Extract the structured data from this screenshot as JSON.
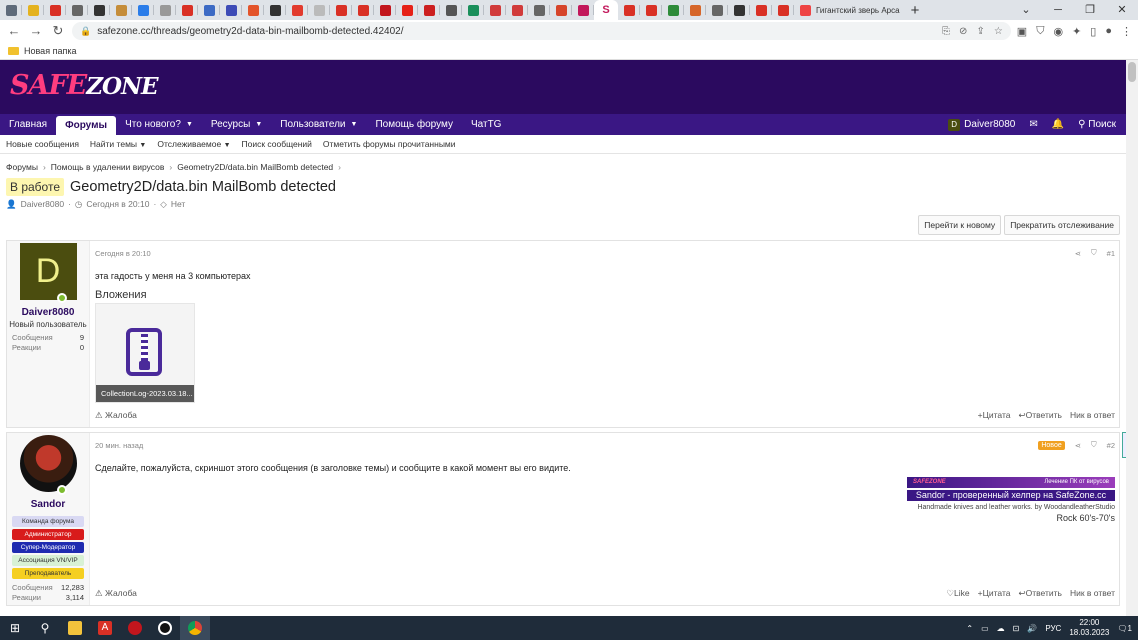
{
  "browser": {
    "tabs": [
      {
        "icon": "gray-tile-icon",
        "color": "#5f6b7a"
      },
      {
        "icon": "yellow-tile-icon",
        "color": "#e4b21f"
      },
      {
        "icon": "acrobat-icon",
        "color": "#d93025"
      },
      {
        "icon": "settings-icon",
        "color": "#666666"
      },
      {
        "icon": "drop-icon",
        "color": "#333333"
      },
      {
        "icon": "image-icon",
        "color": "#c58d3a"
      },
      {
        "icon": "star-icon",
        "color": "#2b7de9"
      },
      {
        "icon": "gear-icon",
        "color": "#999999"
      },
      {
        "icon": "pdf-icon",
        "color": "#d93025"
      },
      {
        "icon": "blue-tile-icon",
        "color": "#3c6ac4"
      },
      {
        "icon": "wb-icon",
        "color": "#3d4bb6"
      },
      {
        "icon": "flame-icon",
        "color": "#e3542b"
      },
      {
        "icon": "circle-icon",
        "color": "#333333"
      },
      {
        "icon": "pin-icon",
        "color": "#e23b2e"
      },
      {
        "icon": "t-icon",
        "color": "#bbbbbb"
      },
      {
        "icon": "acrobat-icon",
        "color": "#d93025"
      },
      {
        "icon": "acrobat-icon",
        "color": "#d93025"
      },
      {
        "icon": "opera-icon",
        "color": "#c2161d"
      },
      {
        "icon": "youtube-icon",
        "color": "#e62117"
      },
      {
        "icon": "tomato-icon",
        "color": "#cc1f1f"
      },
      {
        "icon": "smile-icon",
        "color": "#555555"
      },
      {
        "icon": "green-tile-icon",
        "color": "#1a8f5b"
      },
      {
        "icon": "red-tile-icon",
        "color": "#d13b3b"
      },
      {
        "icon": "blocked-icon",
        "color": "#d13b3b"
      },
      {
        "icon": "globe-icon",
        "color": "#666666"
      },
      {
        "icon": "flower-icon",
        "color": "#d6442a"
      },
      {
        "icon": "safezone-icon",
        "color": "#c2185b"
      }
    ],
    "active_tab_icon": "safezone-icon",
    "tabs_after": [
      {
        "icon": "acrobat-icon",
        "color": "#d93025"
      },
      {
        "icon": "acrobat-icon",
        "color": "#d93025"
      },
      {
        "icon": "green-grid-icon",
        "color": "#2e8b3a"
      },
      {
        "icon": "pizza-icon",
        "color": "#d6662a"
      },
      {
        "icon": "globe-icon",
        "color": "#666666"
      },
      {
        "icon": "circle-icon",
        "color": "#333333"
      },
      {
        "icon": "acrobat-icon",
        "color": "#d93025"
      },
      {
        "icon": "acrobat-icon",
        "color": "#d93025"
      }
    ],
    "wide_tab_title": "Гигантский зверь Арса",
    "address": "safezone.cc/threads/geometry2d-data-bin-mailbomb-detected.42402/",
    "bookmark_folder": "Новая папка"
  },
  "site": {
    "logo_safe": "SAFE",
    "logo_zone": "ZONE",
    "colors": {
      "header": "#2b0a5f",
      "nav": "#3a1784",
      "accent": "#ff3d7f"
    },
    "nav": [
      "Главная",
      "Форумы",
      "Что нового?",
      "Ресурсы",
      "Пользователи",
      "Помощь форуму",
      "ЧатTG"
    ],
    "nav_username": "Daiver8080",
    "nav_user_initial": "D",
    "search": "Поиск",
    "subnav": [
      "Новые сообщения",
      "Найти темы",
      "Отслеживаемое",
      "Поиск сообщений",
      "Отметить форумы прочитанными"
    ]
  },
  "thread": {
    "breadcrumbs": [
      "Форумы",
      "Помощь в удалении вирусов",
      "Geometry2D/data.bin MailBomb detected"
    ],
    "label": "В работе",
    "title": "Geometry2D/data.bin MailBomb detected",
    "meta_author": "Daiver8080",
    "meta_time": "Сегодня в 20:10",
    "meta_tags": "Нет",
    "btn_goto_new": "Перейти к новому",
    "btn_unwatch": "Прекратить отслеживание"
  },
  "posts": [
    {
      "initial": "D",
      "username": "Daiver8080",
      "user_title": "Новый пользователь",
      "messages_label": "Сообщения",
      "messages": "9",
      "reactions_label": "Реакции",
      "reactions": "0",
      "time": "Сегодня в 20:10",
      "number": "#1",
      "text": "эта гадость у меня на 3 компьютерах",
      "attachments_title": "Вложения",
      "attachment_name": "CollectionLog-2023.03.18...",
      "report": "Жалоба",
      "quote": "Цитата",
      "reply": "Ответить",
      "down": "Ник в ответ"
    },
    {
      "username": "Sandor",
      "roles": [
        {
          "label": "Команда форума",
          "bg": "#d9d9f3",
          "fg": "#333333"
        },
        {
          "label": "Администратор",
          "bg": "#d81b1b",
          "fg": "#ffffff"
        },
        {
          "label": "Супер-Модератор",
          "bg": "#1f2bb0",
          "fg": "#ffffff"
        },
        {
          "label": "Ассоциация VN/VIP",
          "bg": "#d8f1d5",
          "fg": "#333333"
        },
        {
          "label": "Преподаватель",
          "bg": "#f5cf21",
          "fg": "#333333"
        }
      ],
      "messages_label": "Сообщения",
      "messages": "12,283",
      "reactions_label": "Реакции",
      "reactions": "3,114",
      "time": "20 мин. назад",
      "badge": "Новое",
      "number": "#2",
      "text": "Сделайте, пожалуйста, скриншот этого сообщения (в заголовке темы) и сообщите в какой момент вы его видите.",
      "sig_banner_left": "SAFEZONE",
      "sig_banner_right": "Лечение ПК от вирусов",
      "sig_line": "Sandor - проверенный хелпер на SafeZone.cc",
      "sig_small": "Handmade knives and leather works. by WoodandleatherStudio",
      "sig_rock": "Rock 60's-70's",
      "report": "Жалоба",
      "like": "Like",
      "quote": "Цитата",
      "reply": "Ответить",
      "down": "Ник в ответ"
    }
  ],
  "taskbar": {
    "lang": "РУС",
    "time": "22:00",
    "date": "18.03.2023",
    "notifications": "1"
  }
}
